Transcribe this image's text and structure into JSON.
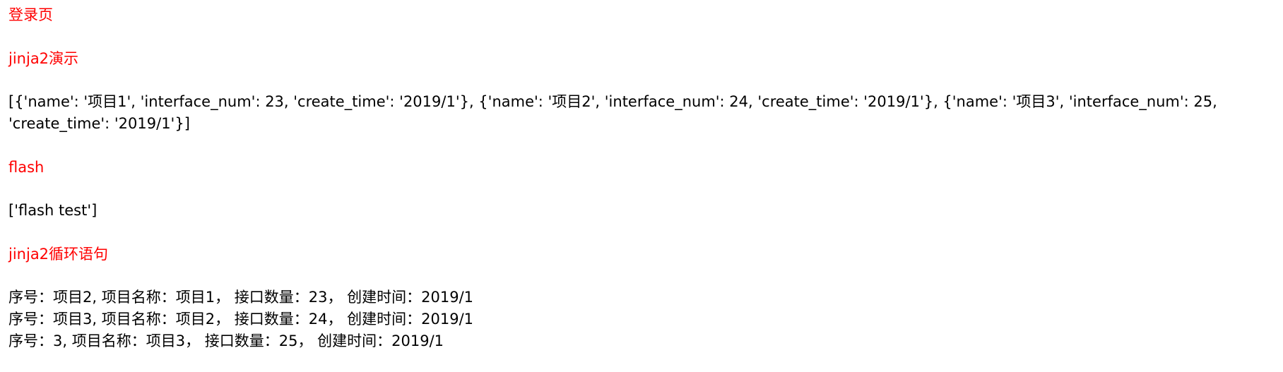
{
  "colors": {
    "link": "#ff0000",
    "text": "#000000",
    "background": "#ffffff"
  },
  "links": {
    "login": "登录页",
    "jinja2_demo": "jinja2演示",
    "flash": "flash",
    "jinja2_loop": "jinja2循环语句"
  },
  "projects_raw": "[{'name': '项目1', 'interface_num': 23, 'create_time': '2019/1'}, {'name': '项目2', 'interface_num': 24, 'create_time': '2019/1'}, {'name': '项目3', 'interface_num': 25, 'create_time': '2019/1'}]",
  "flash_messages": "['flash test']",
  "loop_rows": [
    "序号：项目2, 项目名称：项目1， 接口数量：23， 创建时间：2019/1",
    "序号：项目3, 项目名称：项目2， 接口数量：24， 创建时间：2019/1",
    "序号：3, 项目名称：项目3， 接口数量：25， 创建时间：2019/1"
  ]
}
